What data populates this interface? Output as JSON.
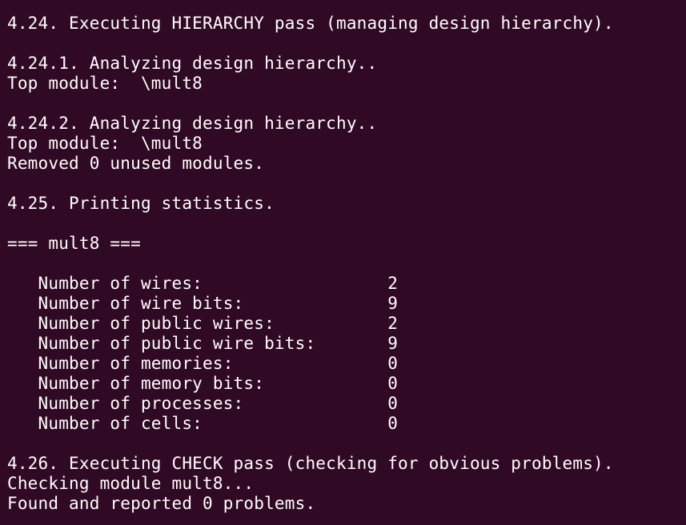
{
  "colors": {
    "background": "#300a24",
    "foreground": "#ffffff"
  },
  "terminal": {
    "lines": [
      "4.24. Executing HIERARCHY pass (managing design hierarchy).",
      "",
      "4.24.1. Analyzing design hierarchy..",
      "Top module:  \\mult8",
      "",
      "4.24.2. Analyzing design hierarchy..",
      "Top module:  \\mult8",
      "Removed 0 unused modules.",
      "",
      "4.25. Printing statistics.",
      "",
      "=== mult8 ===",
      "",
      "   Number of wires:                  2",
      "   Number of wire bits:              9",
      "   Number of public wires:           2",
      "   Number of public wire bits:       9",
      "   Number of memories:               0",
      "   Number of memory bits:            0",
      "   Number of processes:              0",
      "   Number of cells:                  0",
      "",
      "4.26. Executing CHECK pass (checking for obvious problems).",
      "Checking module mult8...",
      "Found and reported 0 problems."
    ]
  }
}
